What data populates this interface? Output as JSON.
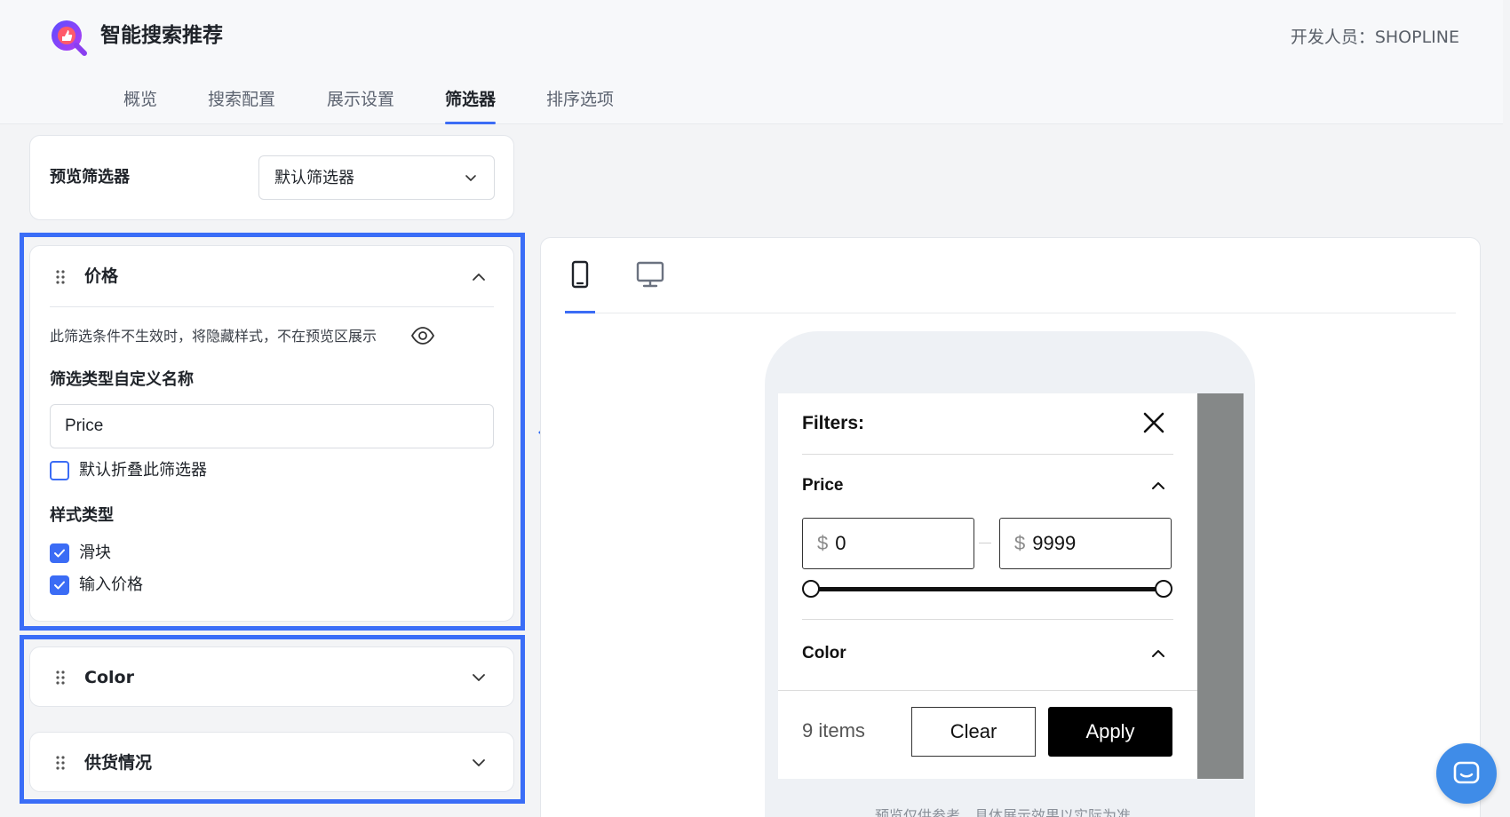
{
  "app": {
    "title": "智能搜索推荐",
    "developer_label": "开发人员：SHOPLINE",
    "brand_color": "#7b3ff2",
    "accent_color": "#3b6cf5"
  },
  "nav": {
    "tabs": [
      {
        "label": "概览",
        "active": false
      },
      {
        "label": "搜索配置",
        "active": false
      },
      {
        "label": "展示设置",
        "active": false
      },
      {
        "label": "筛选器",
        "active": true
      },
      {
        "label": "排序选项",
        "active": false
      }
    ]
  },
  "preview_selector": {
    "label": "预览筛选器",
    "selected": "默认筛选器",
    "icon": "chevron-down-icon"
  },
  "filters": {
    "price": {
      "title": "价格",
      "expanded": true,
      "hint": "此筛选条件不生效时，将隐藏样式，不在预览区展示",
      "hint_icon": "eye-icon",
      "custom_name_label": "筛选类型自定义名称",
      "custom_name_value": "Price",
      "collapse_default_label": "默认折叠此筛选器",
      "collapse_default_checked": false,
      "style_type_label": "样式类型",
      "style_options": [
        {
          "label": "滑块",
          "checked": true
        },
        {
          "label": "输入价格",
          "checked": true
        }
      ]
    },
    "color": {
      "title": "Color",
      "expanded": false
    },
    "supply": {
      "title": "供货情况",
      "expanded": false
    }
  },
  "preview": {
    "devices": [
      {
        "name": "mobile",
        "icon": "mobile-icon",
        "active": true
      },
      {
        "name": "desktop",
        "icon": "desktop-icon",
        "active": false
      }
    ],
    "drawer": {
      "title": "Filters:",
      "price_section": "Price",
      "currency": "$",
      "min": "0",
      "max": "9999",
      "color_section": "Color",
      "items_count": "9 items",
      "clear_label": "Clear",
      "apply_label": "Apply"
    },
    "note": "预览仅供参考，具体展示效果以实际为准"
  },
  "chat": {
    "icon": "chat-icon"
  }
}
